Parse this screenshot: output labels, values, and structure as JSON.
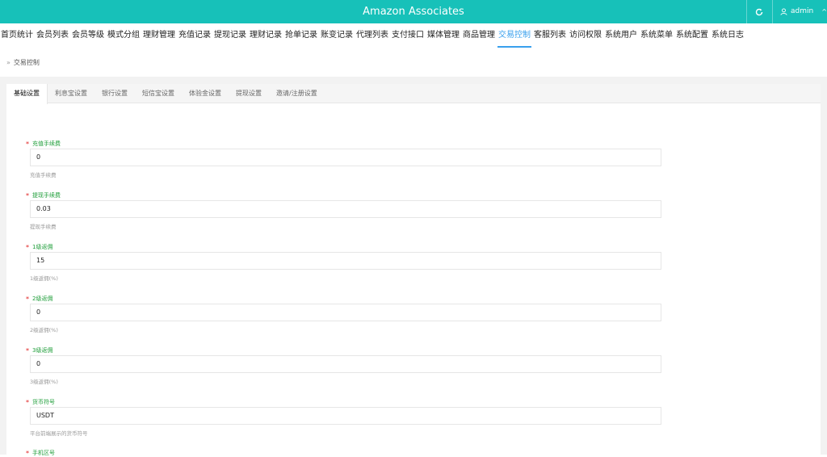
{
  "header": {
    "title": "Amazon Associates",
    "refresh_icon": "refresh-icon",
    "user": {
      "icon": "user-icon",
      "name": "admin",
      "chevron": "^"
    }
  },
  "nav": {
    "items": [
      "首页统计",
      "会员列表",
      "会员等级",
      "模式分组",
      "理财管理",
      "充值记录",
      "提现记录",
      "理财记录",
      "抢单记录",
      "账变记录",
      "代理列表",
      "支付接口",
      "媒体管理",
      "商品管理",
      "交易控制",
      "客服列表",
      "访问权限",
      "系统用户",
      "系统菜单",
      "系统配置",
      "系统日志"
    ],
    "active_index": 14,
    "active_color": "#39a0ed"
  },
  "breadcrumb": {
    "separator": "»",
    "current": "交易控制"
  },
  "tabs": {
    "items": [
      "基础设置",
      "利息宝设置",
      "银行设置",
      "短信宝设置",
      "体验金设置",
      "提现设置",
      "邀请/注册设置"
    ],
    "active_index": 0
  },
  "form": {
    "required_mark": "*",
    "fields": [
      {
        "label": "充值手续费",
        "value": "0",
        "help": "充值手续费"
      },
      {
        "label": "提现手续费",
        "value": "0.03",
        "help": "提现手续费"
      },
      {
        "label": "1级返佣",
        "value": "15",
        "help": "1级返佣(%)"
      },
      {
        "label": "2级返佣",
        "value": "0",
        "help": "2级返佣(%)"
      },
      {
        "label": "3级返佣",
        "value": "0",
        "help": "3级返佣(%)"
      },
      {
        "label": "货币符号",
        "value": "USDT",
        "help": "平台前端展示的货币符号"
      },
      {
        "label": "手机区号",
        "value": "",
        "help": ""
      }
    ]
  },
  "colors": {
    "header_bg": "#17c1b9",
    "label_green": "#1f9e3a",
    "required_red": "#e02020"
  }
}
